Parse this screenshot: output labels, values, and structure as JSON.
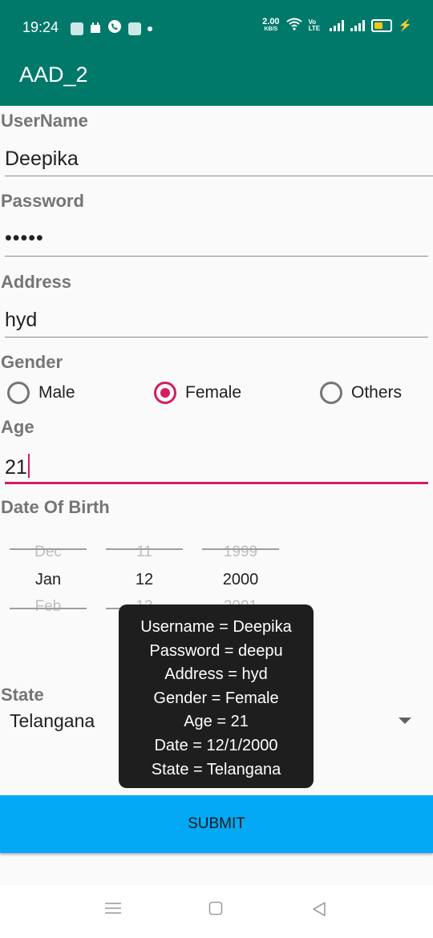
{
  "status_bar": {
    "time": "19:24",
    "net_speed": "2.00",
    "net_unit": "KB/S",
    "volte": "Vo LTE",
    "icons": [
      "gallery-icon",
      "calendar-icon",
      "phone-icon",
      "app-icon",
      "dot-icon",
      "wifi-icon",
      "signal-icon",
      "signal-icon",
      "battery-charging-icon"
    ]
  },
  "app_bar": {
    "title": "AAD_2"
  },
  "form": {
    "username": {
      "label": "UserName",
      "value": "Deepika"
    },
    "password": {
      "label": "Password",
      "value": "•••••"
    },
    "address": {
      "label": "Address",
      "value": "hyd"
    },
    "gender": {
      "label": "Gender",
      "options": [
        "Male",
        "Female",
        "Others"
      ],
      "selected": "Female"
    },
    "age": {
      "label": "Age",
      "value": "21"
    },
    "dob": {
      "label": "Date Of Birth",
      "month": {
        "prev": "Dec",
        "selected": "Jan",
        "next": "Feb"
      },
      "day": {
        "prev": "11",
        "selected": "12",
        "next": "13"
      },
      "year": {
        "prev": "1999",
        "selected": "2000",
        "next": "2001"
      }
    },
    "state": {
      "label": "State",
      "value": "Telangana"
    },
    "submit_label": "SUBMIT"
  },
  "toast": {
    "lines": [
      "Username = Deepika",
      "Password = deepu",
      "Address = hyd",
      "Gender = Female",
      "Age = 21",
      "Date = 12/1/2000",
      "State = Telangana"
    ]
  },
  "colors": {
    "primary": "#00796b",
    "accent": "#d81b60",
    "button": "#03a9f4"
  }
}
